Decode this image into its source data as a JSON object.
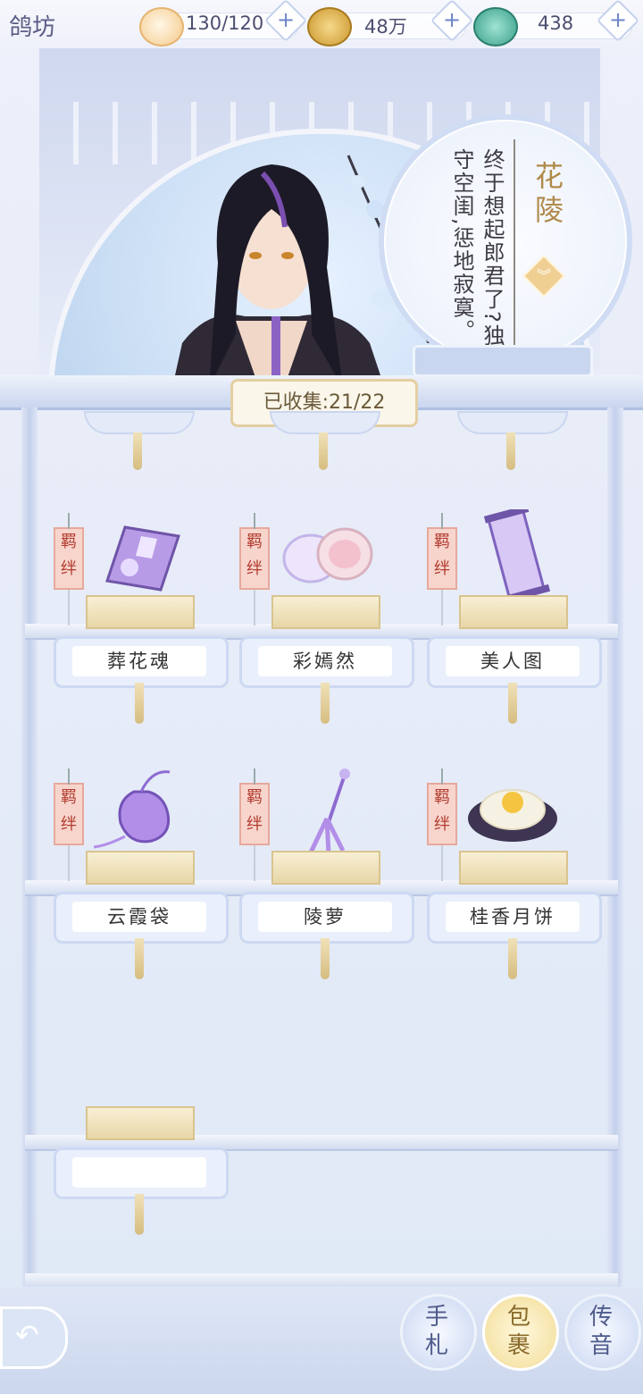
{
  "header": {
    "title": "鸽坊",
    "resources": [
      {
        "icon": "cat-stamina-icon",
        "value": "130/120"
      },
      {
        "icon": "paw-coin-icon",
        "value": "48万"
      },
      {
        "icon": "jade-dragon-icon",
        "value": "438"
      }
    ]
  },
  "character": {
    "name": "花陵",
    "quote": "终于想起郎君了?独守空闺,惩地寂寞。"
  },
  "collection": {
    "label": "已收集:",
    "count": "21/22"
  },
  "tag_text": "羁绊",
  "items": [
    {
      "name": "葬花魂",
      "icon": "book-icon"
    },
    {
      "name": "彩嫣然",
      "icon": "cosmetic-box-icon"
    },
    {
      "name": "美人图",
      "icon": "scroll-icon"
    },
    {
      "name": "云霞袋",
      "icon": "pouch-icon"
    },
    {
      "name": "陵萝",
      "icon": "hairpin-icon"
    },
    {
      "name": "桂香月饼",
      "icon": "mooncake-icon"
    },
    {
      "name": "",
      "icon": ""
    }
  ],
  "nav": {
    "letters": "手札",
    "bag": "包裹",
    "message": "传音"
  }
}
